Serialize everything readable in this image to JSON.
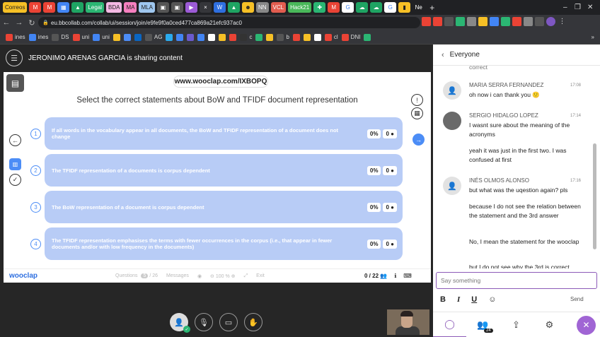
{
  "browser": {
    "tabs": [
      {
        "label": "Correos",
        "color": "#f6c026",
        "text": "#222"
      },
      {
        "label": "M",
        "color": "#ea4335",
        "text": "#fff"
      },
      {
        "label": "M",
        "color": "#ea4335",
        "text": "#fff"
      },
      {
        "label": "▦",
        "color": "#4285f4",
        "text": "#fff"
      },
      {
        "label": "▲",
        "color": "#1fa463",
        "text": "#fff"
      },
      {
        "label": "Legal",
        "color": "#2bb673",
        "text": "#fff"
      },
      {
        "label": "BDA",
        "color": "#f4b9e4",
        "text": "#222"
      },
      {
        "label": "MA",
        "color": "#f57fbf",
        "text": "#222"
      },
      {
        "label": "MLA",
        "color": "#9fc7ef",
        "text": "#222"
      },
      {
        "label": "▣",
        "color": "#555",
        "text": "#fff"
      },
      {
        "label": "▣",
        "color": "#555",
        "text": "#fff"
      },
      {
        "label": "▶",
        "color": "#9c5bd6",
        "text": "#fff"
      },
      {
        "label": "×",
        "color": "#35363a",
        "text": "#fff",
        "active": true
      },
      {
        "label": "W",
        "color": "#2e6fe0",
        "text": "#fff"
      },
      {
        "label": "▲",
        "color": "#1fa463",
        "text": "#fff"
      },
      {
        "label": "☻",
        "color": "#f6c026",
        "text": "#222"
      },
      {
        "label": "NN",
        "color": "#888",
        "text": "#fff"
      },
      {
        "label": "VCL",
        "color": "#e25d4f",
        "text": "#fff"
      },
      {
        "label": "Hack21",
        "color": "#49b85a",
        "text": "#fff"
      },
      {
        "label": "✚",
        "color": "#2bb673",
        "text": "#fff"
      },
      {
        "label": "M",
        "color": "#ea4335",
        "text": "#fff"
      },
      {
        "label": "G",
        "color": "#fff",
        "text": "#4285f4"
      },
      {
        "label": "☁",
        "color": "#1fa463",
        "text": "#fff"
      },
      {
        "label": "☁",
        "color": "#1fa463",
        "text": "#fff"
      },
      {
        "label": "G",
        "color": "#fff",
        "text": "#4285f4"
      },
      {
        "label": "▮",
        "color": "#f6c026",
        "text": "#222"
      },
      {
        "label": "Ne",
        "color": "#202124",
        "text": "#fff"
      }
    ],
    "new_tab_label": "+",
    "window_controls": [
      "–",
      "❐",
      "✕"
    ],
    "url": "eu.bbcollab.com/collab/ui/session/join/e9fe9f0a0ced477ca869a21efc937ac0",
    "bookmarks": [
      {
        "label": "ines",
        "color": "#ea4335"
      },
      {
        "label": "ines",
        "color": "#4285f4"
      },
      {
        "label": "DS",
        "color": "#555"
      },
      {
        "label": "uni",
        "color": "#ea4335"
      },
      {
        "label": "uni",
        "color": "#4285f4"
      },
      {
        "label": "",
        "color": "#f6c026"
      },
      {
        "label": "",
        "color": "#4c8df6"
      },
      {
        "label": "",
        "color": "#0a66c2"
      },
      {
        "label": "AG",
        "color": "#555"
      },
      {
        "label": "",
        "color": "#2aabee"
      },
      {
        "label": "",
        "color": "#4285f4"
      },
      {
        "label": "",
        "color": "#6a5acd"
      },
      {
        "label": "",
        "color": "#4285f4"
      },
      {
        "label": "",
        "color": "#fff"
      },
      {
        "label": "",
        "color": "#f6c026"
      },
      {
        "label": "",
        "color": "#ea4335"
      },
      {
        "label": "c",
        "color": "#333"
      },
      {
        "label": "",
        "color": "#2bb673"
      },
      {
        "label": "",
        "color": "#f6c026"
      },
      {
        "label": "b",
        "color": "#555"
      },
      {
        "label": "",
        "color": "#ea4335"
      },
      {
        "label": "",
        "color": "#f6c026"
      },
      {
        "label": "",
        "color": "#fff"
      },
      {
        "label": "cl",
        "color": "#ea4335"
      },
      {
        "label": "DNI",
        "color": "#ea4335"
      },
      {
        "label": "",
        "color": "#2bb673"
      }
    ],
    "bookmarks_overflow": "»"
  },
  "collab": {
    "menu_icon": "☰",
    "sharing_text": "JERONIMO ARENAS GARCIA is sharing content"
  },
  "wooclap": {
    "event_url": "www.wooclap.com/IXBOPQ",
    "question": "Select the correct statements about BoW and TFIDF document representation",
    "options": [
      {
        "number": "1",
        "text": "If all words in the vocabulary appear in all documents, the BoW and TFIDF representation of a document does not change",
        "percent": "0%",
        "votes": "0"
      },
      {
        "number": "2",
        "text": "The TFIDF representation of a documents is corpus dependent",
        "percent": "0%",
        "votes": "0"
      },
      {
        "number": "3",
        "text": "The BoW representation of a document is corpus dependent",
        "percent": "0%",
        "votes": "0"
      },
      {
        "number": "4",
        "text": "The TFIDF representation emphasises the terms with fewer occurrences in the corpus (i.e., that appear in fewer documents and/or with low frequency in the documents)",
        "percent": "0%",
        "votes": "0"
      }
    ],
    "footer": {
      "logo": "wooclap",
      "questions_label": "Questions",
      "questions_current": "5",
      "questions_total": "/ 26",
      "messages_label": "Messages",
      "zoom": "100 %",
      "exit_label": "Exit",
      "participants": "0 / 22"
    }
  },
  "chat": {
    "title": "Everyone",
    "truncated_top": "correct",
    "messages": [
      {
        "author": "MARIA SERRA FERNANDEZ",
        "time": "17:08",
        "lines": [
          "oh now i can thank you 🙂"
        ]
      },
      {
        "author": "SERGIO HIDALGO LOPEZ",
        "time": "17:14",
        "lines": [
          "I wasnt sure about the meaning of the acronyms",
          "yeah it was just in the first two. I was confused at first"
        ]
      },
      {
        "author": "INÉS OLMOS ALONSO",
        "time": "17:16",
        "lines": [
          "but what was the uqestion again? pls",
          "because I do not see the relation between the statement and the 3rd answer",
          "No, I mean the statement for the wooclap",
          "but I do not see why the 3rd is correct"
        ]
      }
    ],
    "input_placeholder": "Say something",
    "format": {
      "bold": "B",
      "italic": "I",
      "underline": "U",
      "emoji": "☺"
    },
    "send_label": "Send",
    "participant_count": "24"
  }
}
